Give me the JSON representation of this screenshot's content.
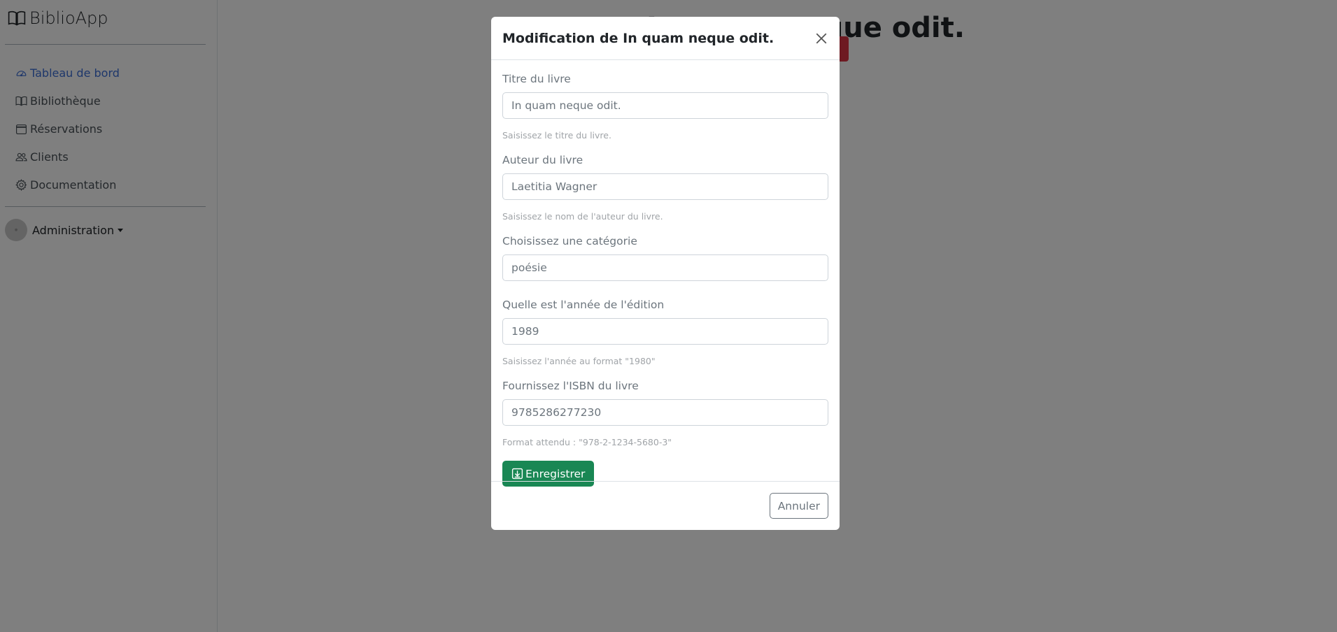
{
  "brand": {
    "name": "BiblioApp",
    "icon": "book-icon"
  },
  "sidebar": {
    "items": [
      {
        "label": "Tableau de bord",
        "icon": "speedometer-icon",
        "active": true
      },
      {
        "label": "Bibliothèque",
        "icon": "book-icon",
        "active": false
      },
      {
        "label": "Réservations",
        "icon": "calendar-icon",
        "active": false
      },
      {
        "label": "Clients",
        "icon": "people-icon",
        "active": false
      },
      {
        "label": "Documentation",
        "icon": "gear-icon",
        "active": false
      }
    ],
    "user": {
      "label": "Administration"
    }
  },
  "main": {
    "title": "In quam neque odit."
  },
  "modal": {
    "title": "Modification de In quam neque odit.",
    "fields": {
      "title": {
        "label": "Titre du livre",
        "value": "In quam neque odit.",
        "help": "Saisissez le titre du livre."
      },
      "author": {
        "label": "Auteur du livre",
        "value": "Laetitia Wagner",
        "help": "Saisissez le nom de l'auteur du livre."
      },
      "category": {
        "label": "Choisissez une catégorie",
        "value": "poésie"
      },
      "year": {
        "label": "Quelle est l'année de l'édition",
        "value": "1989",
        "help": "Saisissez l'année au format \"1980\""
      },
      "isbn": {
        "label": "Fournissez l'ISBN du livre",
        "value": "9785286277230",
        "help": "Format attendu : \"978-2-1234-5680-3\""
      }
    },
    "save_label": "Enregistrer",
    "cancel_label": "Annuler"
  },
  "colors": {
    "accent": "#3d6fd6",
    "success": "#198754",
    "danger": "#dc3545",
    "backdrop": "rgba(0,0,0,0.5)"
  }
}
